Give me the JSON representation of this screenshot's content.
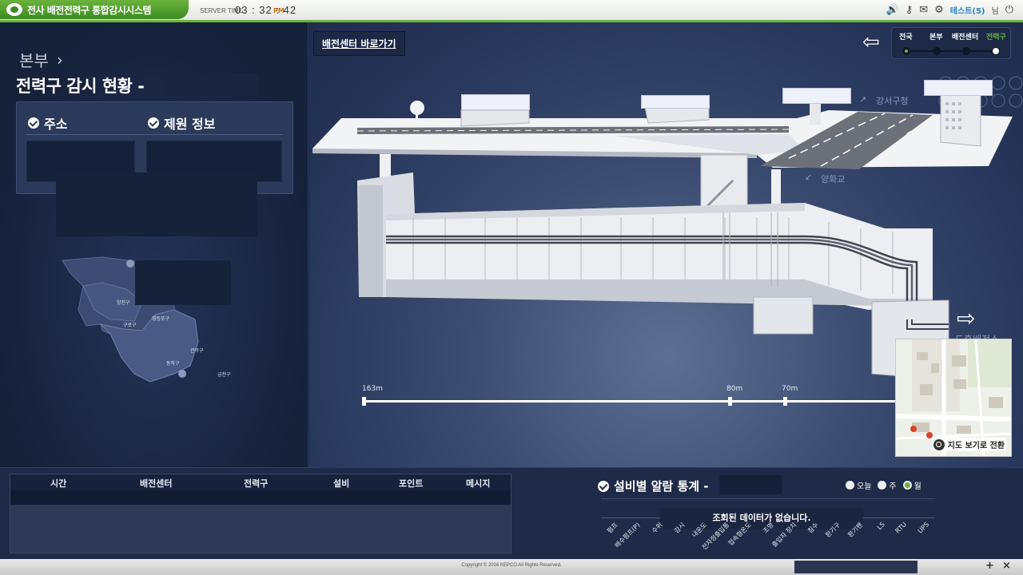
{
  "header": {
    "app_title": "전사 배전전력구 통합감시시스템",
    "server_time_label": "SERVER TIME",
    "server_time": "03 : 32 : 42",
    "server_ampm": "PM",
    "user_name": "테스트(5)",
    "user_suffix": "님",
    "icons": [
      "speaker-icon",
      "key-icon",
      "mail-icon",
      "gear-icon",
      "power-icon"
    ]
  },
  "left": {
    "breadcrumb": "본부",
    "title": "전력구 감시 현황 -",
    "address_label": "주소",
    "equipment_label": "제원 정보",
    "map_labels": [
      "양천구",
      "구로구",
      "영등포구",
      "관악구",
      "동작구",
      "금천구"
    ]
  },
  "main": {
    "shortcut_label": "배전센터 바로가기",
    "levels": [
      "전국",
      "본부",
      "배전센터",
      "전력구"
    ],
    "active_level": "전력구",
    "direction_up": "강서구청",
    "direction_down": "양화교",
    "next_label": "도흥배전소",
    "distances": [
      "163m",
      "80m",
      "70m"
    ],
    "map_toggle_label": "지도 보기로 전환"
  },
  "alarms": {
    "columns": [
      "시간",
      "배전센터",
      "전력구",
      "설비",
      "포인트",
      "메시지"
    ]
  },
  "stats": {
    "title": "설비별 알람 통계 -",
    "periods": [
      "오늘",
      "주",
      "월"
    ],
    "selected_period": "월",
    "no_data": "조회된 데이터가 없습니다.",
    "categories": [
      "펌프",
      "배수펌프(P)",
      "수위",
      "감시",
      "내운도",
      "전자정출입통",
      "접속형온도",
      "조명",
      "출입자 장치",
      "침수",
      "환기구",
      "환기팬",
      "LS",
      "RTU",
      "UPS"
    ]
  },
  "footer": {
    "copyright": "Copyright © 2016 KEPCO All Rights Reserved.",
    "controls": [
      "+",
      "×"
    ]
  }
}
